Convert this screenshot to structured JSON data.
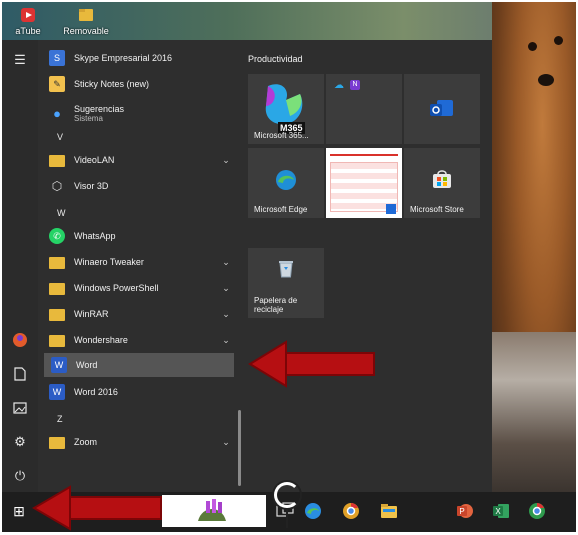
{
  "desktop": {
    "icons": [
      {
        "label": "aTube",
        "icon": "atube-icon"
      },
      {
        "label": "Removable",
        "icon": "removable-folder-icon"
      }
    ]
  },
  "left_rail": {
    "items": [
      {
        "name": "hamburger-icon",
        "glyph": "☰"
      },
      {
        "name": "user-avatar",
        "glyph": "●"
      },
      {
        "name": "documents-icon",
        "glyph": "🗋"
      },
      {
        "name": "pictures-icon",
        "glyph": "▣"
      },
      {
        "name": "settings-gear-icon",
        "glyph": "⚙"
      },
      {
        "name": "power-icon",
        "glyph": "⏻"
      }
    ]
  },
  "app_list": {
    "items": [
      {
        "kind": "app",
        "label": "Skype Empresarial 2016",
        "icon": "skype-business-icon",
        "color": "#3a73d6"
      },
      {
        "kind": "app",
        "label": "Sticky Notes (new)",
        "icon": "sticky-notes-icon",
        "color": "#f2c14e"
      },
      {
        "kind": "app",
        "label": "Sugerencias",
        "sub": "Sistema",
        "icon": "tips-icon",
        "color": "#2d7fd8"
      },
      {
        "kind": "letter",
        "label": "V"
      },
      {
        "kind": "folder",
        "label": "VideoLAN",
        "chevron": "⌄"
      },
      {
        "kind": "app",
        "label": "Visor 3D",
        "icon": "3d-viewer-icon",
        "color": "#6b6b6b"
      },
      {
        "kind": "letter",
        "label": "W"
      },
      {
        "kind": "app",
        "label": "WhatsApp",
        "icon": "whatsapp-icon",
        "color": "#25d366"
      },
      {
        "kind": "folder",
        "label": "Winaero Tweaker",
        "chevron": "⌄"
      },
      {
        "kind": "folder",
        "label": "Windows PowerShell",
        "chevron": "⌄"
      },
      {
        "kind": "folder",
        "label": "WinRAR",
        "chevron": "⌄"
      },
      {
        "kind": "folder",
        "label": "Wondershare",
        "chevron": "⌄"
      },
      {
        "kind": "app",
        "label": "Word",
        "icon": "word-icon",
        "color": "#2b5cc5",
        "selected": true
      },
      {
        "kind": "app",
        "label": "Word 2016",
        "icon": "word-2016-icon",
        "color": "#2b5cc5"
      },
      {
        "kind": "letter",
        "label": "Z"
      },
      {
        "kind": "folder",
        "label": "Zoom",
        "chevron": "⌄"
      }
    ]
  },
  "tiles": {
    "group_title": "Productividad",
    "items": [
      {
        "name": "tile-m365",
        "label": "Microsoft 365...",
        "badge": "M365"
      },
      {
        "name": "tile-office-group",
        "label": ""
      },
      {
        "name": "tile-outlook",
        "label": ""
      },
      {
        "name": "tile-microsoft-edge",
        "label": "Microsoft Edge"
      },
      {
        "name": "tile-calendar-preview",
        "label": ""
      },
      {
        "name": "tile-microsoft-store",
        "label": "Microsoft Store"
      },
      {
        "name": "tile-recycle-bin",
        "label": "Papelera de reciclaje"
      }
    ]
  },
  "taskbar": {
    "items": [
      {
        "name": "start-button",
        "glyph": "⊞"
      },
      {
        "name": "taskbar-edge-icon",
        "color": "#2a8de0"
      },
      {
        "name": "taskbar-chrome-icon",
        "color": "#e0a028"
      },
      {
        "name": "taskbar-file-explorer-icon",
        "color": "#f0c24a"
      },
      {
        "name": "taskbar-powerpoint-icon",
        "color": "#c9452b"
      },
      {
        "name": "taskbar-excel-icon",
        "color": "#1f7a45"
      },
      {
        "name": "taskbar-chrome-2-icon",
        "color": "#2f9a4d"
      }
    ]
  },
  "colors": {
    "arrow_red": "#b60f12",
    "start_menu_bg": "#2e2e2e",
    "selected_row_bg": "#555555"
  }
}
